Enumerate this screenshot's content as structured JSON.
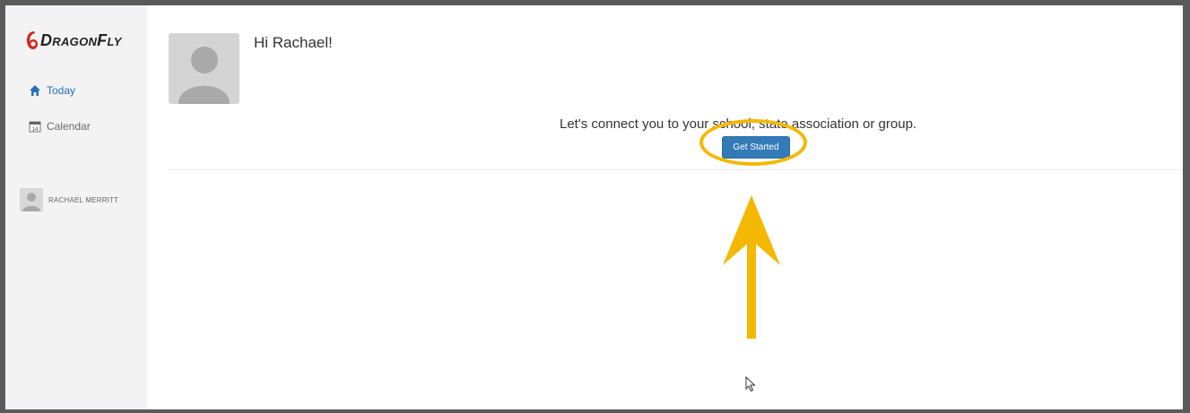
{
  "app": {
    "logo_text": "DragonFly",
    "brand_color": "#d02a1e"
  },
  "sidebar": {
    "items": [
      {
        "label": "Today",
        "icon": "home-icon",
        "active": true
      },
      {
        "label": "Calendar",
        "icon": "calendar-icon",
        "active": false
      }
    ],
    "user_name": "RACHAEL MERRITT",
    "calendar_day": "14"
  },
  "main": {
    "greeting": "Hi Rachael!",
    "connect_text": "Let's connect you to your school, state association or group.",
    "get_started_label": "Get Started"
  },
  "annotations": {
    "highlight_color": "#f5b800",
    "arrow": "up-arrow-icon"
  },
  "colors": {
    "accent": "#337ab7",
    "nav_active": "#2a6ebb",
    "sidebar_bg": "#f3f3f3",
    "frame_border": "#5a5a5c"
  }
}
